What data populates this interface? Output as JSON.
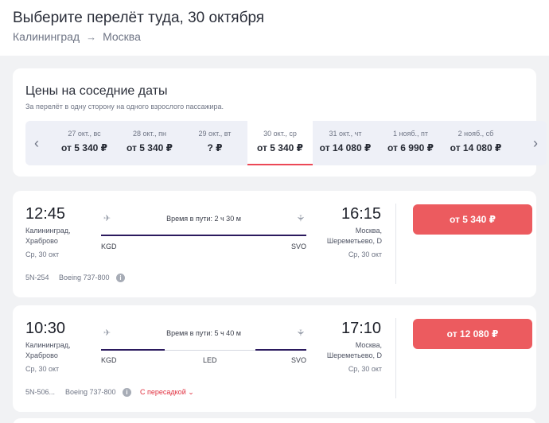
{
  "header": {
    "title": "Выберите перелёт туда, 30 октября",
    "origin": "Калининград",
    "destination": "Москва",
    "route_arrow": "→"
  },
  "prices": {
    "title": "Цены на соседние даты",
    "subtitle": "За перелёт в одну сторону на одного взрослого пассажира.",
    "prev": "‹",
    "next": "›",
    "dates": [
      {
        "label": "27 окт., вс",
        "price": "от 5 340 ₽"
      },
      {
        "label": "28 окт., пн",
        "price": "от 5 340 ₽"
      },
      {
        "label": "29 окт., вт",
        "price": "? ₽"
      },
      {
        "label": "30 окт., ср",
        "price": "от 5 340 ₽",
        "selected": true
      },
      {
        "label": "31 окт., чт",
        "price": "от 14 080 ₽"
      },
      {
        "label": "1 нояб., пт",
        "price": "от 6 990 ₽"
      },
      {
        "label": "2 нояб., сб",
        "price": "от 14 080 ₽"
      }
    ]
  },
  "flights": [
    {
      "dep_time": "12:45",
      "dep_place_1": "Калининград,",
      "dep_place_2": "Храброво",
      "dep_date": "Ср, 30 окт",
      "duration": "Время в пути: 2 ч 30 м",
      "dep_code": "KGD",
      "arr_code": "SVO",
      "arr_time": "16:15",
      "arr_place_1": "Москва,",
      "arr_place_2": "Шереметьево, D",
      "arr_date": "Ср, 30 окт",
      "price": "от 5 340 ₽",
      "flight_number": "5N-254",
      "aircraft": "Boeing 737-800",
      "info": "i"
    },
    {
      "dep_time": "10:30",
      "dep_place_1": "Калининград,",
      "dep_place_2": "Храброво",
      "dep_date": "Ср, 30 окт",
      "duration": "Время в пути: 5 ч 40 м",
      "dep_code": "KGD",
      "via_code": "LED",
      "arr_code": "SVO",
      "arr_time": "17:10",
      "arr_place_1": "Москва,",
      "arr_place_2": "Шереметьево, D",
      "arr_date": "Ср, 30 окт",
      "price": "от 12 080 ₽",
      "flight_number": "5N-506...",
      "aircraft": "Boeing 737-800",
      "info": "i",
      "transfer": "С пересадкой ⌄"
    }
  ],
  "icons": {
    "plane_takeoff": "✈",
    "plane_landing": "✈"
  },
  "colors": {
    "accent": "#ec5b5f",
    "route_line": "#2b1a5e",
    "transfer": "#e0303f"
  }
}
